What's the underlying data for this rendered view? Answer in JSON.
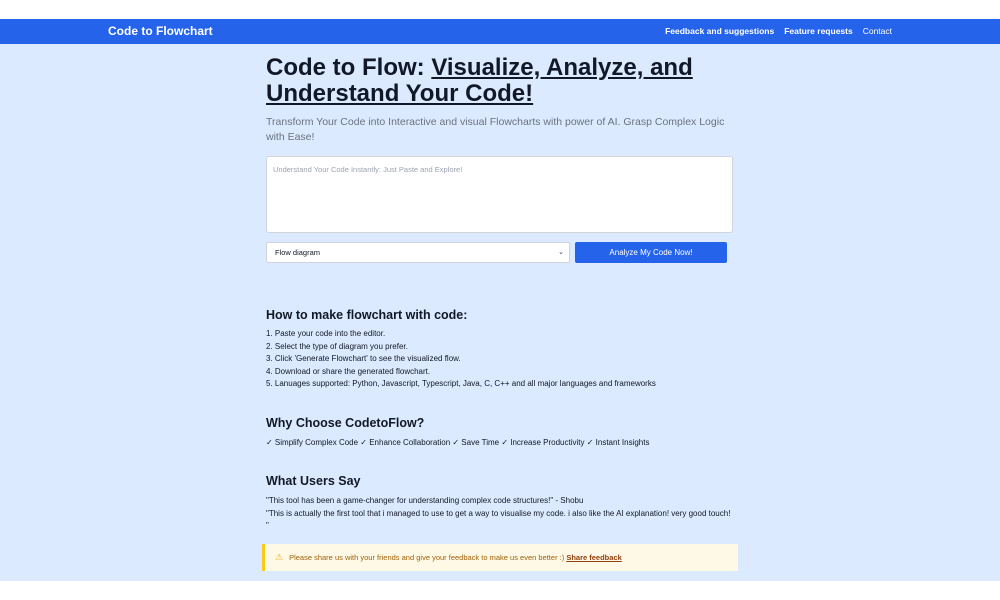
{
  "nav": {
    "brand": "Code to Flowchart",
    "links": [
      "Feedback and suggestions",
      "Feature requests",
      "Contact"
    ]
  },
  "hero": {
    "title_plain": "Code to Flow: ",
    "title_underlined": "Visualize, Analyze, and Understand Your Code!",
    "subtitle": "Transform Your Code into Interactive and visual Flowcharts with power of AI. Grasp Complex Logic with Ease!"
  },
  "editor": {
    "placeholder": "Understand Your Code Instantly: Just Paste and Explore!",
    "value": ""
  },
  "controls": {
    "diagram_type": "Flow diagram",
    "analyze_label": "Analyze My Code Now!"
  },
  "how_to": {
    "heading": "How to make flowchart with code:",
    "steps": [
      "1. Paste your code into the editor.",
      "2. Select the type of diagram you prefer.",
      "3. Click 'Generate Flowchart' to see the visualized flow.",
      "4. Download or share the generated flowchart.",
      "5. Lanuages supported: Python, Javascript, Typescript, Java, C, C++ and all major languages and frameworks"
    ]
  },
  "why": {
    "heading": "Why Choose CodetoFlow?",
    "benefits": "✓ Simplify Complex Code ✓ Enhance Collaboration ✓ Save Time ✓ Increase Productivity ✓ Instant Insights"
  },
  "testimonials": {
    "heading": "What Users Say",
    "quotes": [
      "\"This tool has been a game-changer for understanding complex code structures!\" - Shobu",
      "\"This is actually the first tool that i managed to use to get a way to visualise my code. i also like the AI explanation! very good touch! \""
    ]
  },
  "alert": {
    "icon": "warning-icon",
    "message": "Please share us with your friends and give your feedback to make us even better :)",
    "link": "Share feedback"
  },
  "colors": {
    "primary": "#2563eb",
    "page_bg": "#dbeafe",
    "alert_bg": "#fef9e7",
    "alert_border": "#facc15"
  }
}
